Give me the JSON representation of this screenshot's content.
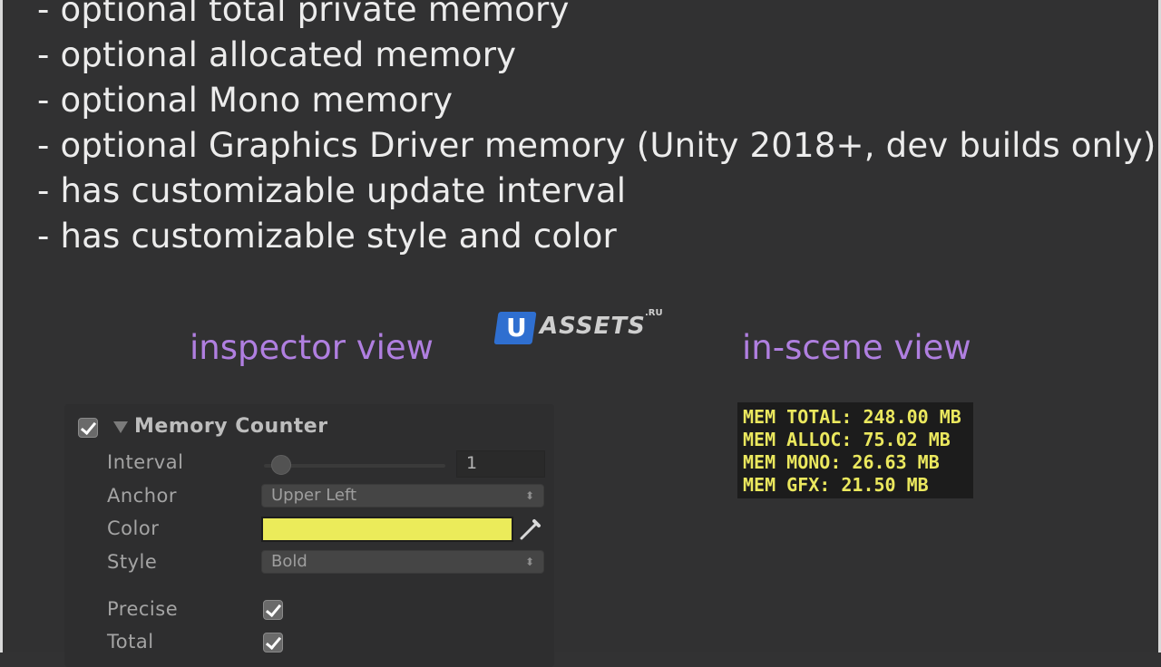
{
  "features": [
    "- optional total private memory",
    "- optional allocated memory",
    "- optional Mono memory",
    "- optional Graphics Driver memory (Unity 2018+, dev builds only)",
    "- has customizable update interval",
    "- has customizable style and color"
  ],
  "captions": {
    "inspector": "inspector view",
    "scene": "in-scene view"
  },
  "watermark": {
    "badge": "U",
    "text": "ASSETS",
    "suffix": ".RU"
  },
  "inspector": {
    "component_title": "Memory Counter",
    "component_enabled": true,
    "fields": {
      "interval": {
        "label": "Interval",
        "value": "1",
        "slider_fraction": 0.05
      },
      "anchor": {
        "label": "Anchor",
        "value": "Upper Left"
      },
      "color": {
        "label": "Color",
        "value": "#EBEB5A"
      },
      "style": {
        "label": "Style",
        "value": "Bold"
      },
      "precise": {
        "label": "Precise",
        "checked": true
      },
      "total": {
        "label": "Total",
        "checked": true
      }
    },
    "icons": {
      "dropdown": "up-down-arrows-icon",
      "picker": "eyedropper-icon",
      "foldout": "triangle-down-icon"
    }
  },
  "scene": {
    "lines": [
      "MEM TOTAL: 248.00 MB",
      "MEM ALLOC: 75.02 MB",
      "MEM MONO: 26.63 MB",
      "MEM GFX: 21.50 MB"
    ],
    "text_color": "#EBE85E",
    "background": "#1C1C1C"
  }
}
